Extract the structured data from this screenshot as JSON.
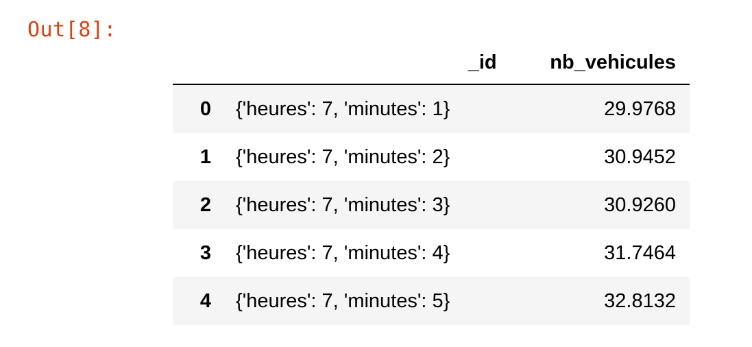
{
  "cell": {
    "out_prompt": "Out[8]:"
  },
  "dataframe": {
    "columns": [
      "",
      "_id",
      "nb_vehicules"
    ],
    "rows": [
      {
        "index": "0",
        "_id": "{'heures': 7, 'minutes': 1}",
        "nb_vehicules": "29.9768"
      },
      {
        "index": "1",
        "_id": "{'heures': 7, 'minutes': 2}",
        "nb_vehicules": "30.9452"
      },
      {
        "index": "2",
        "_id": "{'heures': 7, 'minutes': 3}",
        "nb_vehicules": "30.9260"
      },
      {
        "index": "3",
        "_id": "{'heures': 7, 'minutes': 4}",
        "nb_vehicules": "31.7464"
      },
      {
        "index": "4",
        "_id": "{'heures': 7, 'minutes': 5}",
        "nb_vehicules": "32.8132"
      }
    ]
  },
  "colors": {
    "prompt": "#d84315",
    "stripe": "#f5f5f5",
    "text": "#000000"
  }
}
